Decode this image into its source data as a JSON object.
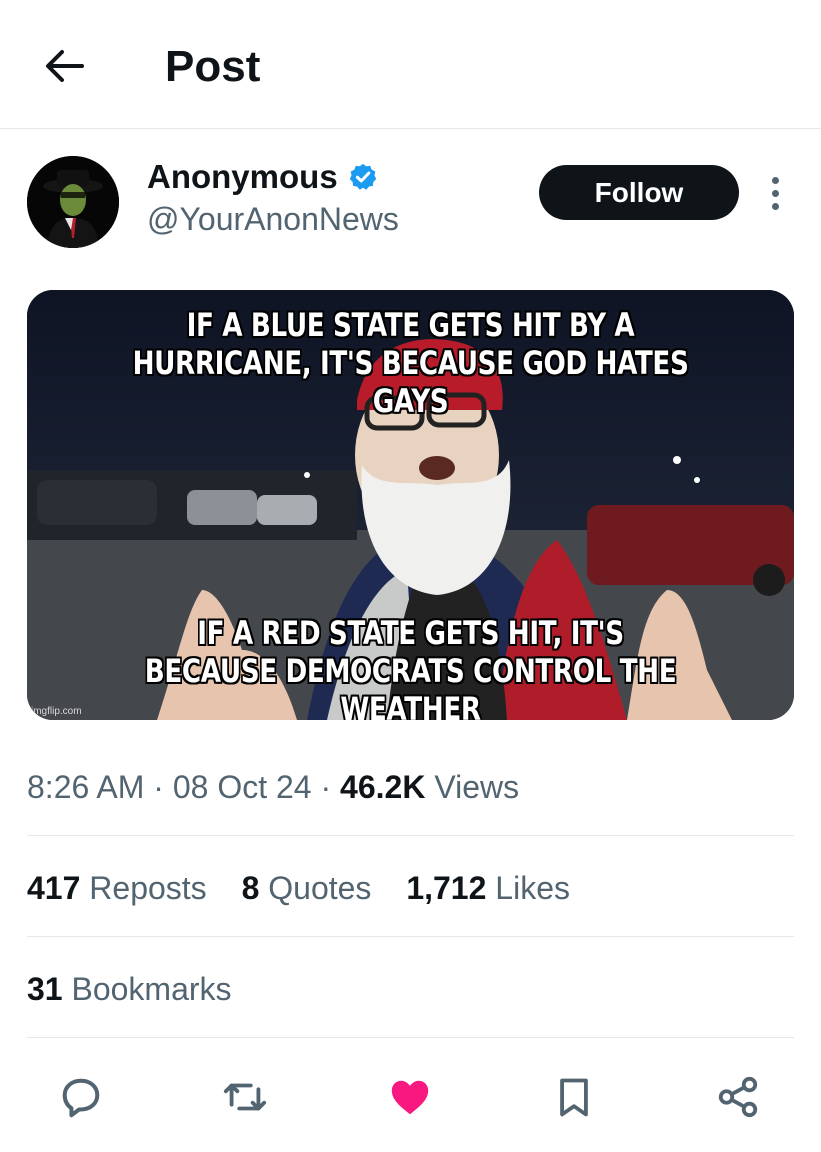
{
  "header": {
    "title": "Post"
  },
  "author": {
    "name": "Anonymous",
    "handle": "@YourAnonNews",
    "follow_label": "Follow"
  },
  "media": {
    "top_caption": "IF A BLUE STATE GETS HIT BY A\nHURRICANE, IT'S BECAUSE GOD HATES GAYS",
    "bottom_caption": "IF A RED STATE GETS HIT, IT'S\nBECAUSE DEMOCRATS CONTROL THE WEATHER",
    "watermark": "imgflip.com"
  },
  "meta": {
    "time": "8:26 AM",
    "date": "08 Oct 24",
    "views_count": "46.2K",
    "views_label": "Views"
  },
  "stats": {
    "reposts_count": "417",
    "reposts_label": "Reposts",
    "quotes_count": "8",
    "quotes_label": "Quotes",
    "likes_count": "1,712",
    "likes_label": "Likes",
    "bookmarks_count": "31",
    "bookmarks_label": "Bookmarks"
  },
  "actions": {
    "icons": [
      "reply-icon",
      "repost-icon",
      "like-icon",
      "bookmark-icon",
      "share-icon"
    ],
    "liked": true
  },
  "colors": {
    "verified": "#1d9bf0",
    "like": "#f91880",
    "muted_text": "#536471",
    "text": "#0f1419",
    "follow_bg": "#0f1419"
  }
}
